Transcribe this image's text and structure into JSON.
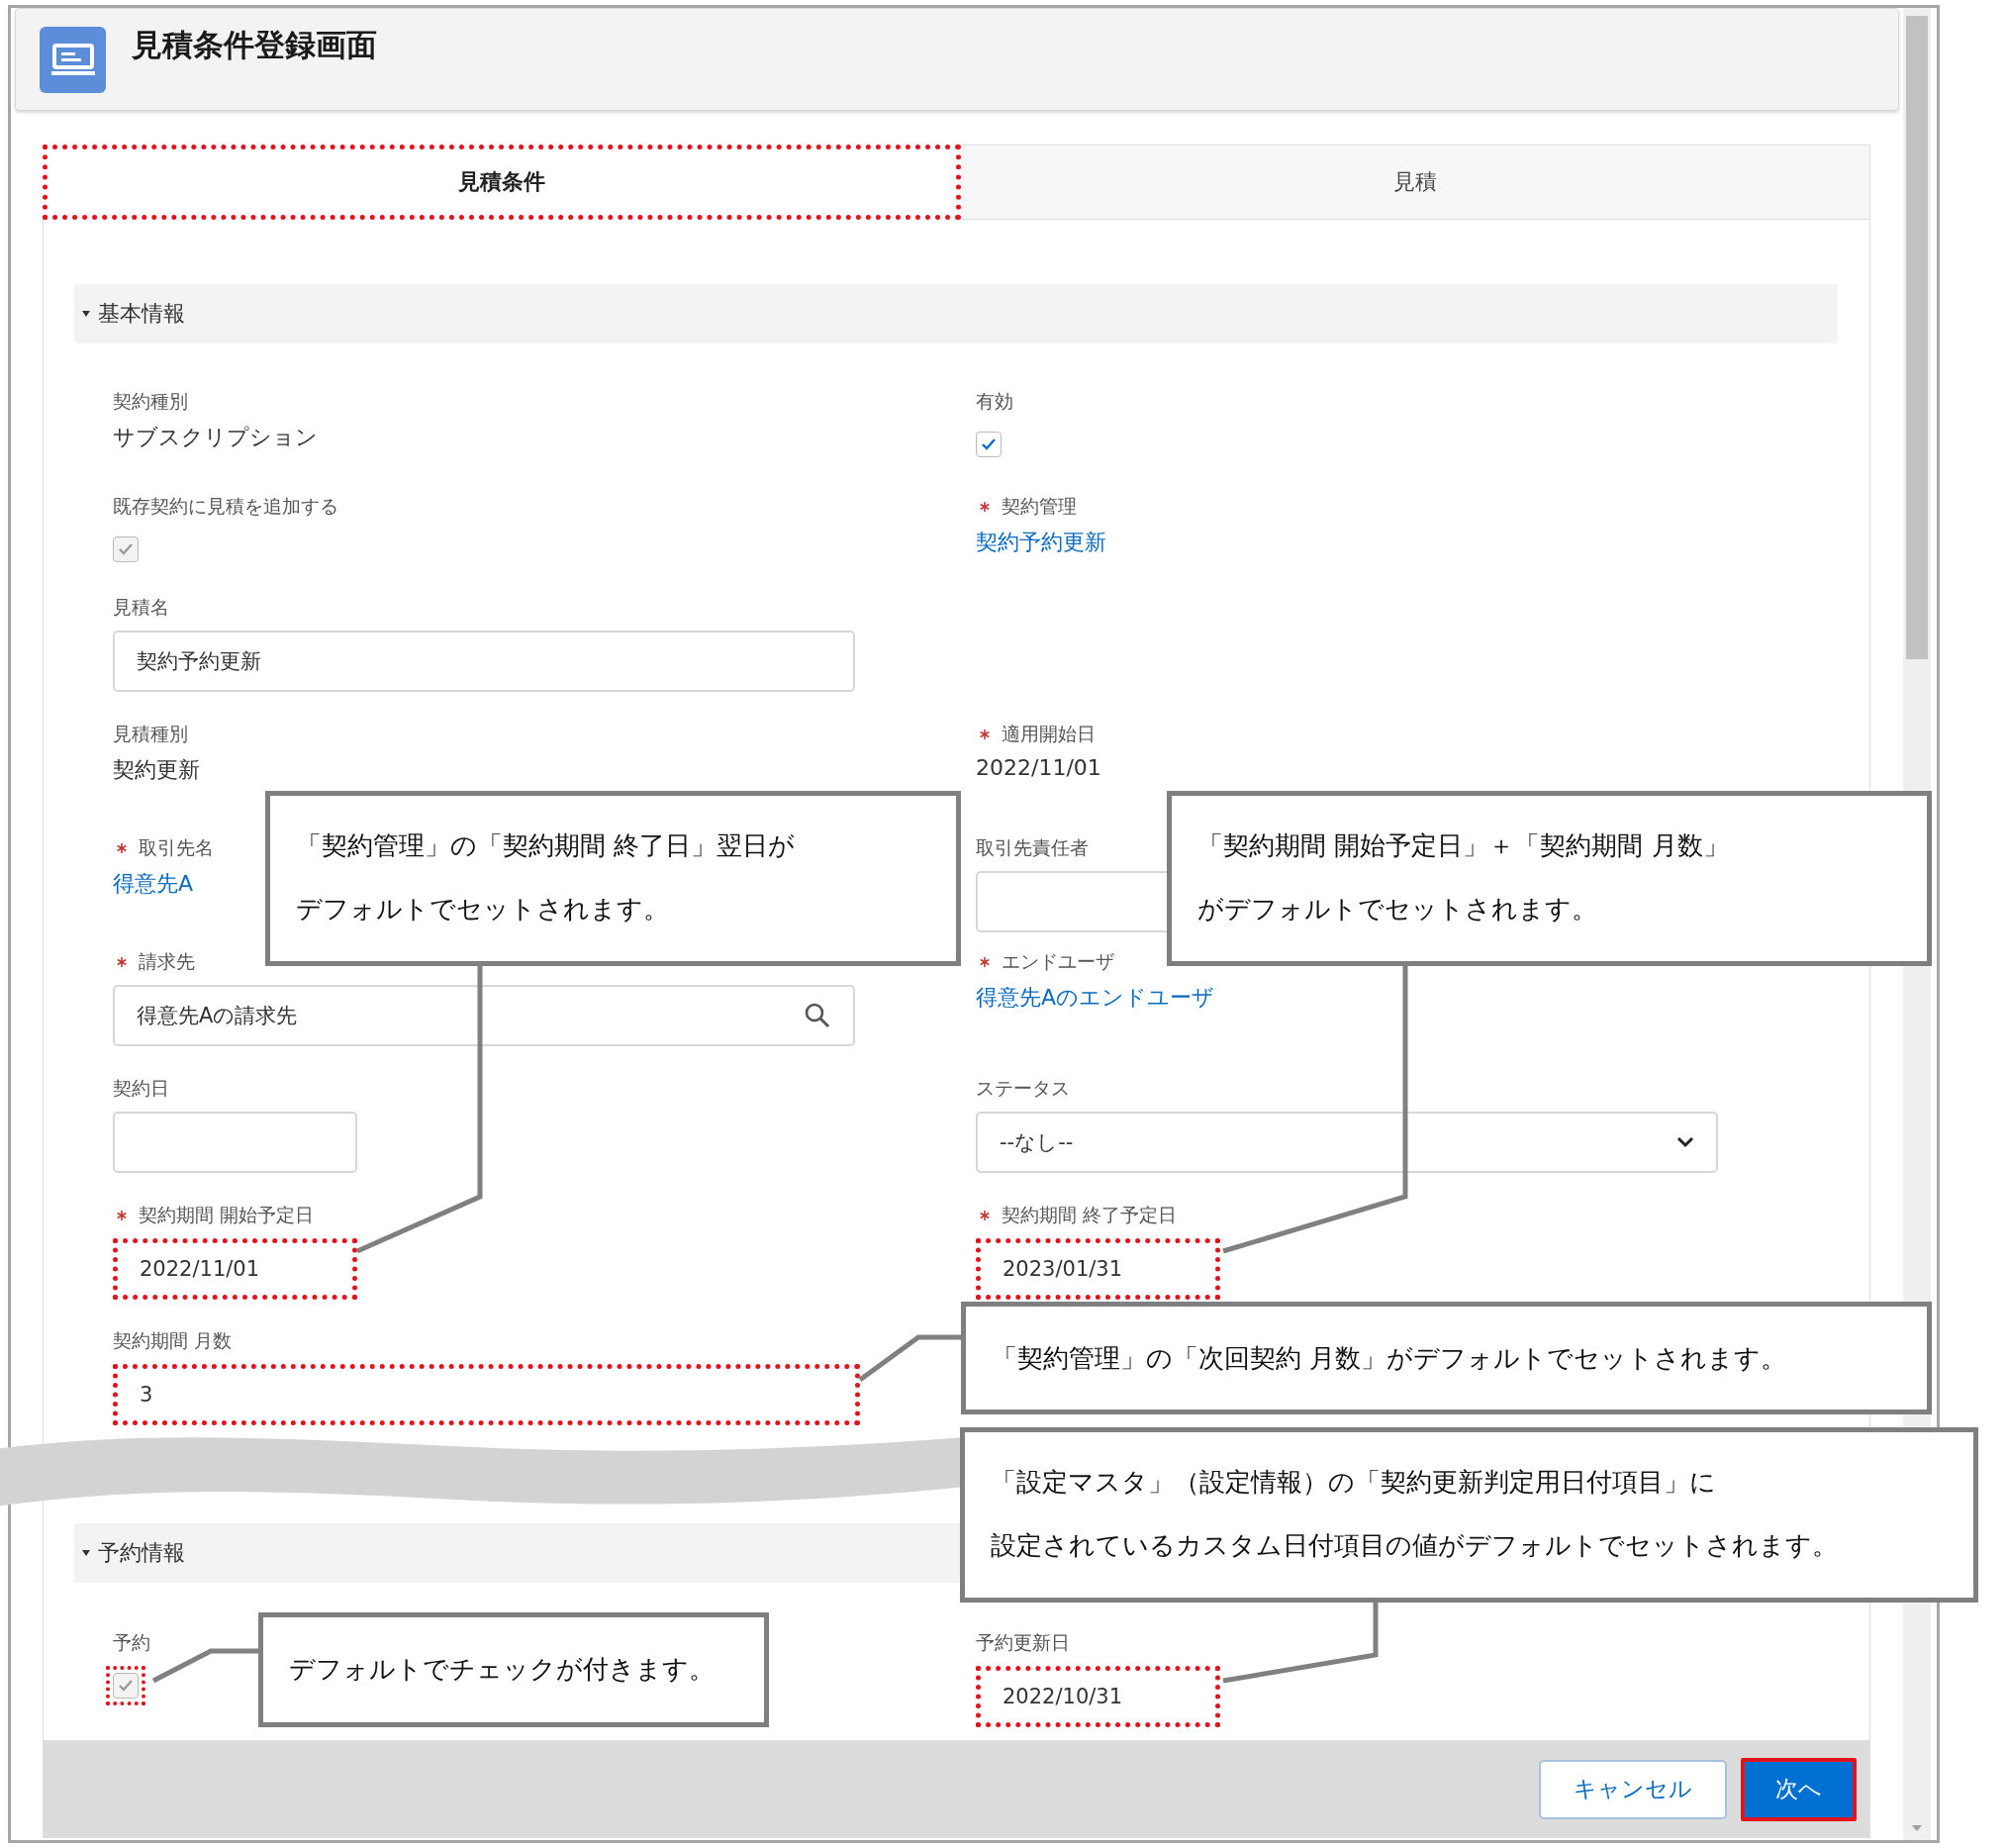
{
  "header": {
    "title": "見積条件登録画面"
  },
  "tabs": [
    {
      "label": "見積条件",
      "selected": true,
      "highlighted": true
    },
    {
      "label": "見積",
      "selected": false,
      "highlighted": false
    }
  ],
  "sections": [
    {
      "title": "基本情報",
      "expanded": true,
      "rows": [
        {
          "left": {
            "kind": "text",
            "label": "契約種別",
            "value": "サブスクリプション",
            "required": false
          },
          "right": {
            "kind": "checkbox",
            "label": "有効",
            "checked": true,
            "disabled": false,
            "required": false,
            "highlighted": false
          }
        },
        {
          "left": {
            "kind": "checkbox",
            "label": "既存契約に見積を追加する",
            "checked": true,
            "disabled": true,
            "required": false,
            "highlighted": false
          },
          "right": {
            "kind": "link",
            "label": "契約管理",
            "value": "契約予約更新",
            "required": true
          }
        },
        {
          "left": {
            "kind": "input",
            "label": "見積名",
            "value": "契約予約更新",
            "required": false,
            "highlighted": false
          }
        },
        {
          "left": {
            "kind": "text",
            "label": "見積種別",
            "value": "契約更新",
            "required": false
          },
          "right": {
            "kind": "text",
            "label": "適用開始日",
            "value": "2022/11/01",
            "required": true
          }
        },
        {
          "left": {
            "kind": "link",
            "label": "取引先名",
            "value": "得意先A",
            "required": true
          },
          "right": {
            "kind": "input",
            "label": "取引先責任者",
            "required": false,
            "highlighted": false
          }
        },
        {
          "left": {
            "kind": "lookup",
            "label": "請求先",
            "value": "得意先Aの請求先",
            "required": true,
            "highlighted": false
          },
          "right": {
            "kind": "link",
            "label": "エンドユーザ",
            "value": "得意先Aのエンドユーザ",
            "required": true
          }
        },
        {
          "left": {
            "kind": "date",
            "label": "契約日",
            "required": false,
            "highlighted": false
          },
          "right": {
            "kind": "select",
            "label": "ステータス",
            "value": "--なし--",
            "required": false,
            "highlighted": false
          }
        },
        {
          "left": {
            "kind": "date",
            "label": "契約期間 開始予定日",
            "value": "2022/11/01",
            "required": true,
            "highlighted": true
          },
          "right": {
            "kind": "date",
            "label": "契約期間 終了予定日",
            "value": "2023/01/31",
            "required": true,
            "highlighted": true
          }
        },
        {
          "left": {
            "kind": "number",
            "label": "契約期間 月数",
            "value": "3",
            "required": false,
            "highlighted": true
          }
        }
      ]
    },
    {
      "title": "予約情報",
      "expanded": true,
      "rows": [
        {
          "left": {
            "kind": "checkbox",
            "label": "予約",
            "checked": true,
            "disabled": true,
            "required": false,
            "highlighted": true
          },
          "right": {
            "kind": "date",
            "label": "予約更新日",
            "value": "2022/10/31",
            "required": false,
            "highlighted": true
          }
        }
      ]
    }
  ],
  "buttons": [
    {
      "kind": "neutral",
      "label": "キャンセル",
      "highlighted": false
    },
    {
      "kind": "brand",
      "label": "次へ",
      "highlighted": true
    }
  ],
  "annotations": [
    {
      "lines": [
        "「契約管理」の「契約期間 終了日」翌日が",
        "デフォルトでセットされます。"
      ]
    },
    {
      "lines": [
        "「契約期間 開始予定日」＋「契約期間 月数」",
        "がデフォルトでセットされます。"
      ]
    },
    {
      "lines": [
        "「契約管理」の「次回契約 月数」がデフォルトでセットされます。"
      ]
    },
    {
      "lines": [
        "「設定マスタ」（設定情報）の「契約更新判定用日付項目」に",
        "設定されているカスタム日付項目の値がデフォルトでセットされます。"
      ]
    },
    {
      "lines": [
        "デフォルトでチェックが付きます。"
      ]
    }
  ]
}
